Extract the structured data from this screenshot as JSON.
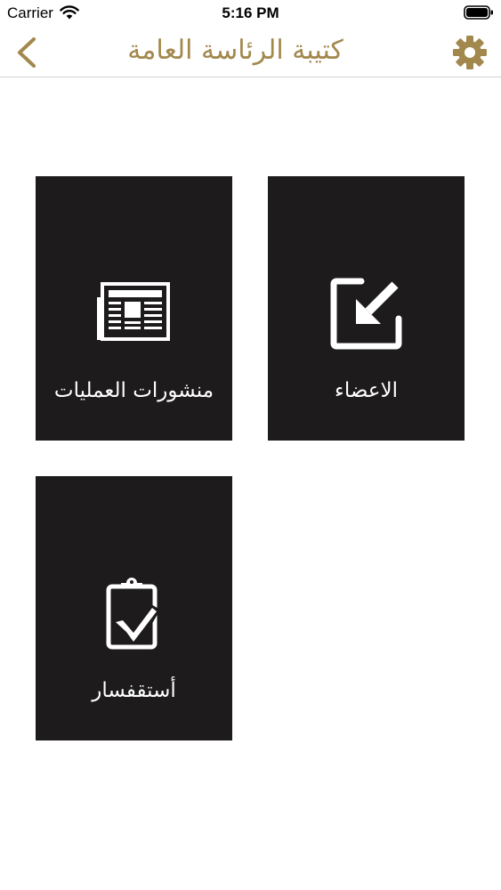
{
  "status_bar": {
    "carrier": "Carrier",
    "time": "5:16 PM"
  },
  "nav": {
    "title": "كتيبة الرئاسة العامة",
    "back_icon": "chevron-left-icon",
    "settings_icon": "gear-icon",
    "accent_color": "#a3884d"
  },
  "tiles": [
    {
      "label": "الاعضاء",
      "icon": "import-arrow-icon"
    },
    {
      "label": "منشورات العمليات",
      "icon": "newspaper-icon"
    },
    {
      "label": "أستقفسار",
      "icon": "clipboard-check-icon"
    }
  ],
  "colors": {
    "tile_background": "#1d1b1c",
    "tile_text": "#ffffff"
  }
}
